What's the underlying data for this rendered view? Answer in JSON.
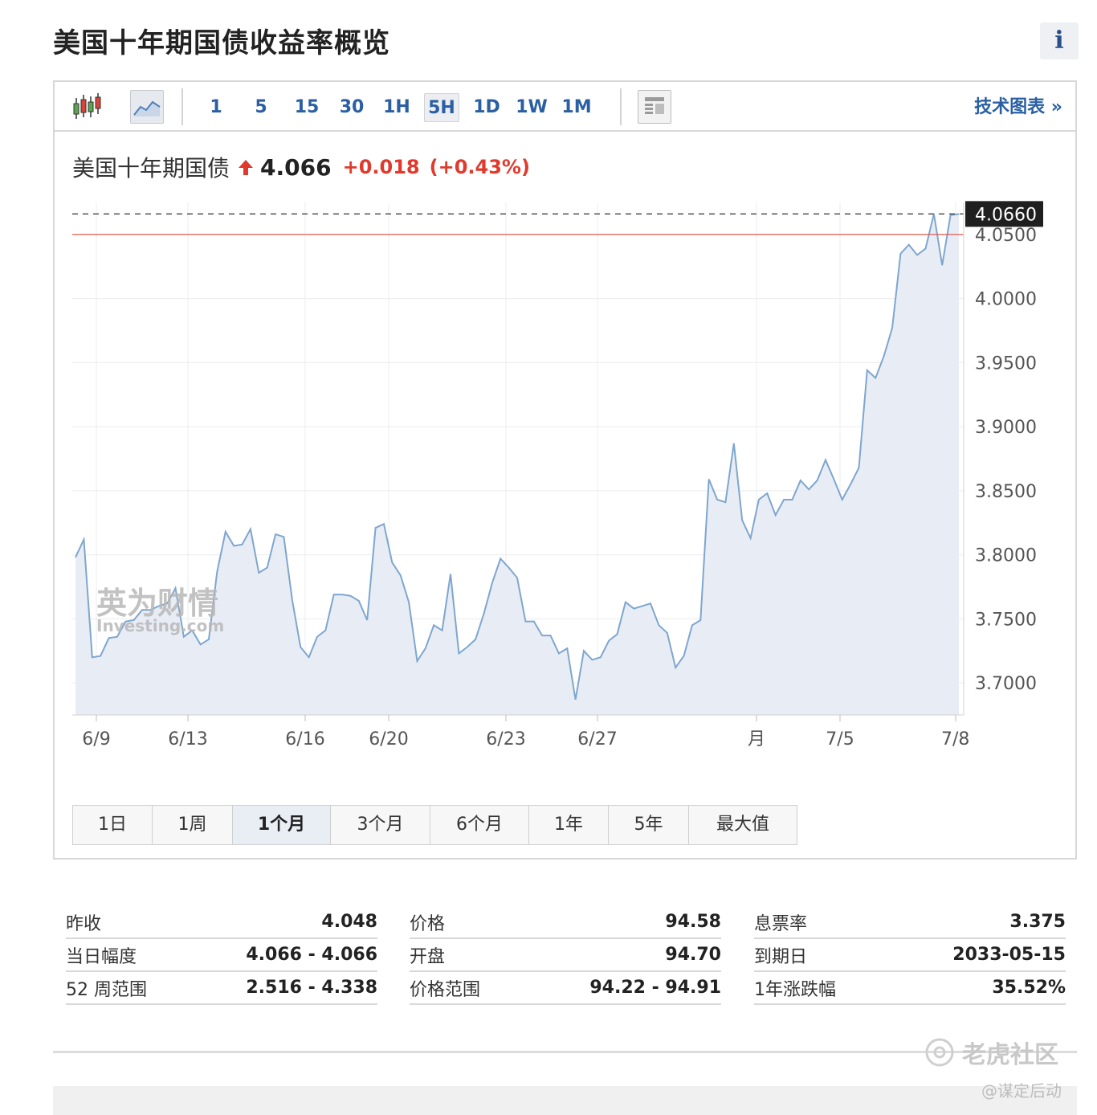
{
  "page": {
    "title": "美国十年期国债收益率概览",
    "info_label": "i"
  },
  "toolbar": {
    "intervals": [
      "1",
      "5",
      "15",
      "30",
      "1H",
      "5H",
      "1D",
      "1W",
      "1M"
    ],
    "active_interval": "5H",
    "tech_chart_label": "技术图表 »"
  },
  "quote": {
    "name": "美国十年期国债",
    "price": "4.066",
    "change": "+0.018",
    "change_pct": "(+0.43%)",
    "direction": "up"
  },
  "chart_data": {
    "type": "area",
    "title": "",
    "xlabel": "",
    "ylabel": "",
    "x_ticks": [
      "6/9",
      "6/13",
      "6/16",
      "6/20",
      "6/23",
      "6/27",
      "月",
      "7/5",
      "7/8"
    ],
    "y_ticks": [
      "3.7000",
      "3.7500",
      "3.8000",
      "3.8500",
      "3.9000",
      "3.9500",
      "4.0000",
      "4.0500"
    ],
    "ylim": [
      3.675,
      4.075
    ],
    "previous_close": 4.05,
    "last_value": 4.066,
    "last_label": "4.0660",
    "grid": true,
    "colors": {
      "line": "#7ea6cf",
      "fill": "#e8edf5",
      "prev_close": "#e05a4e",
      "last_box": "#1f1f1f"
    },
    "watermark": [
      "英为财情",
      "Investing.com"
    ],
    "series": [
      {
        "values": [
          3.798,
          3.812,
          3.72,
          3.721,
          3.735,
          3.736,
          3.748,
          3.749,
          3.757,
          3.757,
          3.76,
          3.762,
          3.774,
          3.736,
          3.741,
          3.73,
          3.734,
          3.787,
          3.818,
          3.807,
          3.808,
          3.82,
          3.786,
          3.79,
          3.816,
          3.814,
          3.765,
          3.728,
          3.72,
          3.736,
          3.741,
          3.769,
          3.769,
          3.768,
          3.764,
          3.749,
          3.821,
          3.824,
          3.794,
          3.784,
          3.763,
          3.717,
          3.727,
          3.745,
          3.741,
          3.785,
          3.723,
          3.728,
          3.734,
          3.754,
          3.778,
          3.797,
          3.79,
          3.782,
          3.748,
          3.748,
          3.737,
          3.737,
          3.723,
          3.727,
          3.687,
          3.725,
          3.718,
          3.72,
          3.733,
          3.738,
          3.763,
          3.758,
          3.76,
          3.762,
          3.745,
          3.739,
          3.712,
          3.721,
          3.745,
          3.749,
          3.859,
          3.843,
          3.841,
          3.887,
          3.827,
          3.813,
          3.843,
          3.848,
          3.831,
          3.843,
          3.843,
          3.858,
          3.851,
          3.858,
          3.874,
          3.859,
          3.843,
          3.855,
          3.868,
          3.944,
          3.938,
          3.955,
          3.977,
          4.035,
          4.042,
          4.034,
          4.039,
          4.066,
          4.026,
          4.065,
          4.066
        ]
      }
    ]
  },
  "ranges": {
    "items": [
      "1日",
      "1周",
      "1个月",
      "3个月",
      "6个月",
      "1年",
      "5年",
      "最大值"
    ],
    "active": "1个月"
  },
  "stats": {
    "col1": [
      {
        "label": "昨收",
        "value": "4.048"
      },
      {
        "label": "当日幅度",
        "value": "4.066 - 4.066"
      },
      {
        "label": "52 周范围",
        "value": "2.516 - 4.338"
      }
    ],
    "col2": [
      {
        "label": "价格",
        "value": "94.58"
      },
      {
        "label": "开盘",
        "value": "94.70"
      },
      {
        "label": "价格范围",
        "value": "94.22 - 94.91"
      }
    ],
    "col3": [
      {
        "label": "息票率",
        "value": "3.375"
      },
      {
        "label": "到期日",
        "value": "2033-05-15"
      },
      {
        "label": "1年涨跌幅",
        "value": "35.52%"
      }
    ]
  },
  "footer_watermark": {
    "brand": "老虎社区",
    "user": "@谋定后动"
  }
}
